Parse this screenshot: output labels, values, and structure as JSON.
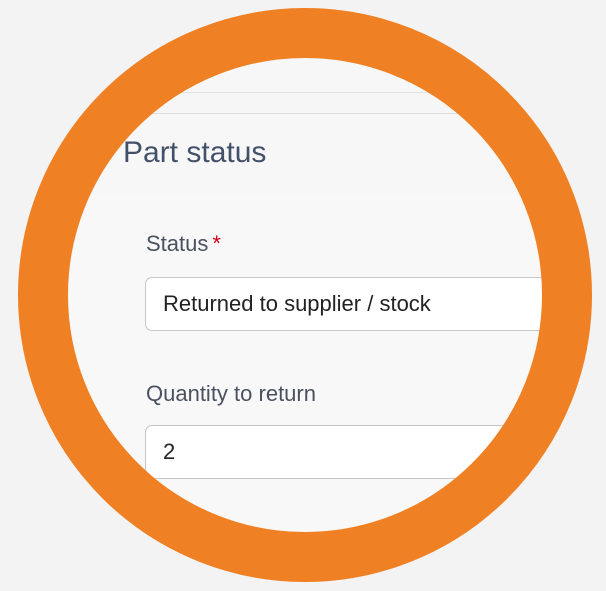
{
  "panel": {
    "title": "Part status"
  },
  "fields": {
    "status": {
      "label": "Status",
      "required_mark": "*",
      "value": "Returned to supplier / stock"
    },
    "quantity_to_return": {
      "label": "Quantity to return",
      "value": "2"
    }
  },
  "colors": {
    "accent_ring": "#f08024",
    "required": "#d0021b",
    "title_text": "#43506a"
  }
}
